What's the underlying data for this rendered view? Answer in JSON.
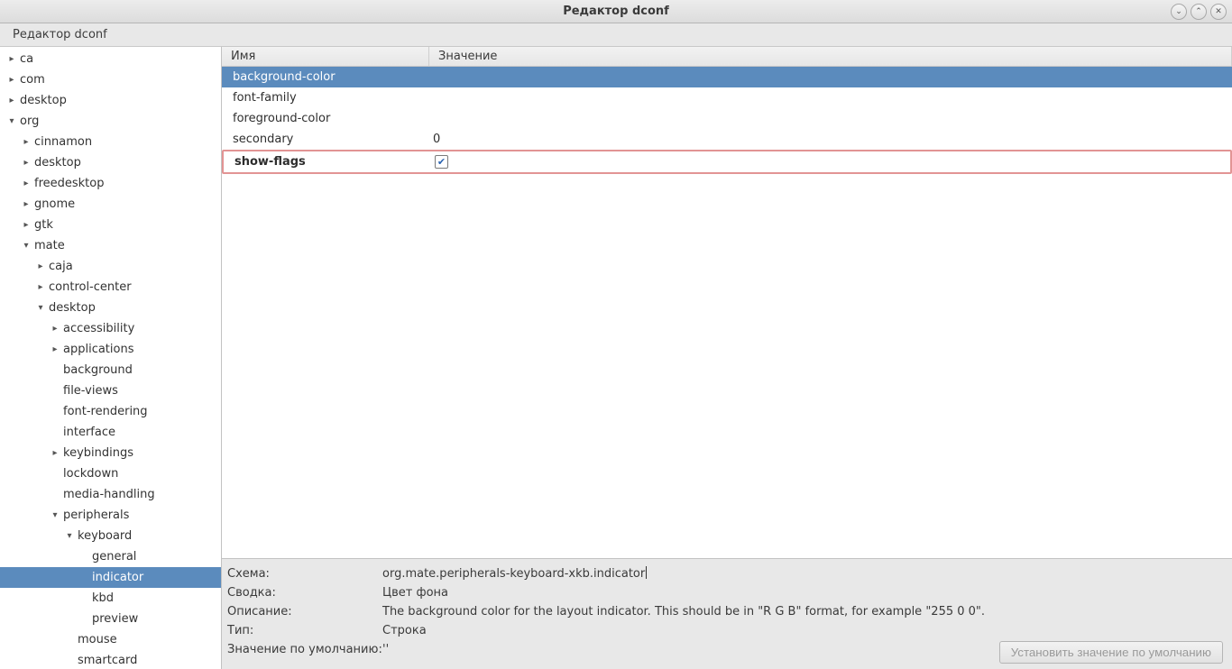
{
  "window": {
    "title": "Редактор dconf"
  },
  "window_controls": {
    "min": "⌄",
    "max": "⌃",
    "close": "✕"
  },
  "menubar": {
    "item1": "Редактор dconf"
  },
  "tree": {
    "ca": "ca",
    "com": "com",
    "desktop": "desktop",
    "org": "org",
    "cinnamon": "cinnamon",
    "org_desktop": "desktop",
    "freedesktop": "freedesktop",
    "gnome": "gnome",
    "gtk": "gtk",
    "mate": "mate",
    "caja": "caja",
    "control_center": "control-center",
    "mate_desktop": "desktop",
    "accessibility": "accessibility",
    "applications": "applications",
    "background": "background",
    "file_views": "file-views",
    "font_rendering": "font-rendering",
    "interface": "interface",
    "keybindings": "keybindings",
    "lockdown": "lockdown",
    "media_handling": "media-handling",
    "peripherals": "peripherals",
    "keyboard": "keyboard",
    "general": "general",
    "indicator": "indicator",
    "kbd": "kbd",
    "preview": "preview",
    "mouse": "mouse",
    "smartcard": "smartcard"
  },
  "list": {
    "header_name": "Имя",
    "header_value": "Значение",
    "rows": [
      {
        "name": "background-color",
        "value": ""
      },
      {
        "name": "font-family",
        "value": ""
      },
      {
        "name": "foreground-color",
        "value": ""
      },
      {
        "name": "secondary",
        "value": "0"
      },
      {
        "name": "show-flags",
        "value_checked": true
      }
    ]
  },
  "details": {
    "schema_label": "Схема:",
    "schema_value": "org.mate.peripherals-keyboard-xkb.indicator",
    "summary_label": "Сводка:",
    "summary_value": "Цвет фона",
    "description_label": "Описание:",
    "description_value": "The background color for the layout indicator. This should be in \"R G B\" format, for example \"255 0 0\".",
    "type_label": "Тип:",
    "type_value": "Строка",
    "default_label": "Значение по умолчанию:",
    "default_value": "''",
    "reset_button": "Установить значение по умолчанию"
  }
}
